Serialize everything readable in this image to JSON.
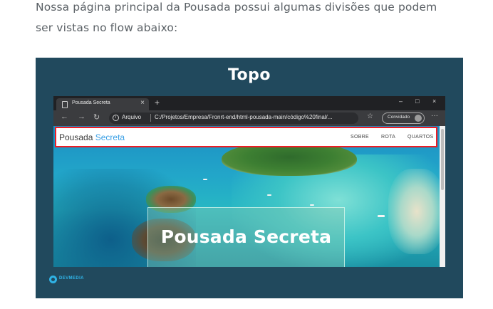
{
  "article": {
    "intro_line1": "Nossa página principal da Pousada possui algumas divisões que podem",
    "intro_line2": "ser vistas no flow abaixo:"
  },
  "figure": {
    "title": "Topo",
    "background_color": "#21495d",
    "brand_text": "DEVMEDIA",
    "browser": {
      "tab_title": "Pousada Secreta",
      "tab_close": "×",
      "new_tab": "+",
      "window_buttons": [
        "–",
        "□",
        "×"
      ],
      "nav_buttons": [
        "←",
        "→",
        "↻"
      ],
      "url_label": "Arquivo",
      "url": "C:/Projetos/Empresa/Fronrt-end/html-pousada-main/código%20final/...",
      "profile_label": "Convidado",
      "more_menu": "···",
      "favorite_icon": "☆"
    },
    "site": {
      "logo_main": "Pousada",
      "logo_accent": "Secreta",
      "nav_links": [
        "SOBRE",
        "ROTA",
        "QUARTOS"
      ],
      "hero_title": "Pousada Secreta",
      "highlight_color": "#ee1c24",
      "accent_color": "#3aa0e6"
    }
  }
}
